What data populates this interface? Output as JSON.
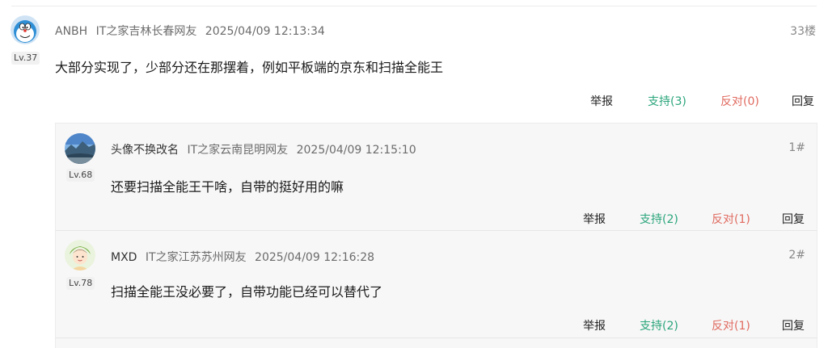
{
  "main_comment": {
    "username": "ANBH",
    "location": "IT之家吉林长春网友",
    "time": "2025/04/09 12:13:34",
    "floor": "33楼",
    "level": "Lv.37",
    "content": "大部分实现了，少部分还在那摆着，例如平板端的京东和扫描全能王",
    "actions": {
      "report": "举报",
      "support": "支持(3)",
      "oppose": "反对(0)",
      "reply": "回复"
    }
  },
  "replies": [
    {
      "username": "头像不换改名",
      "location": "IT之家云南昆明网友",
      "time": "2025/04/09 12:15:10",
      "floor": "1#",
      "level": "Lv.68",
      "content": "还要扫描全能王干啥，自带的挺好用的嘛",
      "actions": {
        "report": "举报",
        "support": "支持(2)",
        "oppose": "反对(1)",
        "reply": "回复"
      }
    },
    {
      "username": "MXD",
      "location": "IT之家江苏苏州网友",
      "time": "2025/04/09 12:16:28",
      "floor": "2#",
      "level": "Lv.78",
      "content": "扫描全能王没必要了，自带功能已经可以替代了",
      "actions": {
        "report": "举报",
        "support": "支持(2)",
        "oppose": "反对(1)",
        "reply": "回复"
      }
    }
  ],
  "colors": {
    "support": "#2aa57a",
    "oppose": "#e06a5f",
    "panel_bg": "#f7f7f7"
  }
}
